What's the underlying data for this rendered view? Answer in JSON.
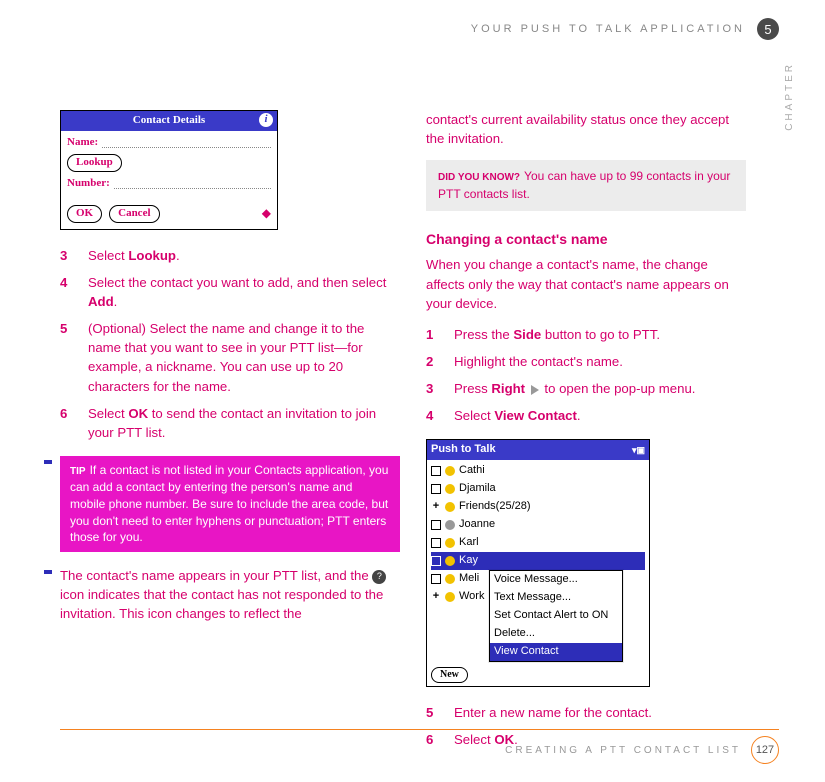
{
  "header": {
    "section_title": "YOUR PUSH TO TALK APPLICATION",
    "chapter_number": "5",
    "chapter_label": "CHAPTER"
  },
  "dialog_contact_details": {
    "title": "Contact Details",
    "name_label": "Name:",
    "lookup_btn": "Lookup",
    "number_label": "Number:",
    "ok_btn": "OK",
    "cancel_btn": "Cancel"
  },
  "left_steps": [
    {
      "n": "3",
      "text_a": "Select ",
      "bold1": "Lookup",
      "text_b": "."
    },
    {
      "n": "4",
      "text_a": "Select the contact you want to add, and then select ",
      "bold1": "Add",
      "text_b": "."
    },
    {
      "n": "5",
      "text_a": "(Optional) Select the name and change it to the name that you want to see in your PTT list—for example, a nickname. You can use up to 20 characters for the name."
    },
    {
      "n": "6",
      "text_a": "Select ",
      "bold1": "OK",
      "text_b": " to send the contact an invitation to join your PTT list."
    }
  ],
  "tip": {
    "label": "TIP",
    "text": "If a contact is not listed in your Contacts application, you can add a contact by entering the person's name and mobile phone number. Be sure to include the area code, but you don't need to enter hyphens or punctuation; PTT enters those for you."
  },
  "left_para": "The contact's name appears in your PTT list, and the ",
  "left_para_after_icon": " icon indicates that the contact has not responded to the invitation. This icon changes to reflect the",
  "right_intro": "contact's current availability status once they accept the invitation.",
  "did_you_know": {
    "label": "DID YOU KNOW?",
    "text": "You can have up to 99 contacts in your PTT contacts list."
  },
  "subhead": "Changing a contact's name",
  "subhead_para": "When you change a contact's name, the change affects only the way that contact's name appears on your device.",
  "right_steps_a": [
    {
      "n": "1",
      "text_a": "Press the ",
      "bold1": "Side",
      "text_b": " button to go to PTT."
    },
    {
      "n": "2",
      "text_a": "Highlight the contact's name."
    },
    {
      "n": "3",
      "text_a": "Press ",
      "bold1": "Right",
      "text_b": " to open the pop-up menu.",
      "has_triangle": true
    },
    {
      "n": "4",
      "text_a": "Select ",
      "bold1": "View Contact",
      "text_b": "."
    }
  ],
  "ptt": {
    "title": "Push to Talk",
    "items": [
      "Cathi",
      "Djamila",
      "Friends(25/28)",
      "Joanne",
      "Karl",
      "Kay",
      "Meli",
      "Work"
    ],
    "popup": [
      "Voice Message...",
      "Text Message...",
      "Set Contact Alert to ON",
      "Delete...",
      "View Contact"
    ],
    "new_btn": "New"
  },
  "right_steps_b": [
    {
      "n": "5",
      "text_a": "Enter a new name for the contact."
    },
    {
      "n": "6",
      "text_a": "Select ",
      "bold1": "OK",
      "text_b": "."
    }
  ],
  "footer": {
    "title": "CREATING A PTT CONTACT LIST",
    "page": "127"
  }
}
